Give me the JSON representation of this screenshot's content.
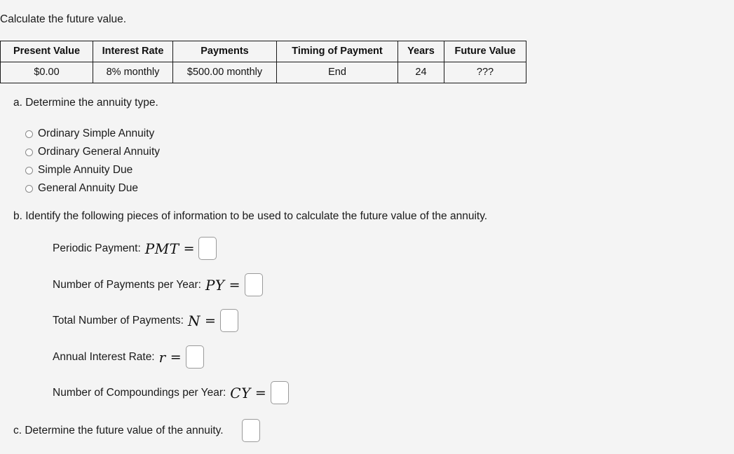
{
  "intro": {
    "text": "Calculate the future value."
  },
  "table": {
    "headers": [
      "Present Value",
      "Interest Rate",
      "Payments",
      "Timing of Payment",
      "Years",
      "Future Value"
    ],
    "rows": [
      [
        "$0.00",
        "8% monthly",
        "$500.00 monthly",
        "End",
        "24",
        "???"
      ]
    ]
  },
  "part_a": {
    "prompt": "a. Determine the annuity type.",
    "options": [
      {
        "label": "Ordinary Simple Annuity",
        "selected": false
      },
      {
        "label": "Ordinary General Annuity",
        "selected": false
      },
      {
        "label": "Simple Annuity Due",
        "selected": false
      },
      {
        "label": "General Annuity Due",
        "selected": false
      }
    ]
  },
  "part_b": {
    "prompt": "b. Identify the following pieces of information to be used to calculate the future value of the annuity.",
    "fields": [
      {
        "label": "Periodic Payment:",
        "symbol": "PMT",
        "equals": "=",
        "value": ""
      },
      {
        "label": "Number of Payments per Year:",
        "symbol": "PY",
        "equals": "=",
        "value": ""
      },
      {
        "label": "Total Number of Payments:",
        "symbol": "N",
        "equals": "=",
        "value": ""
      },
      {
        "label": "Annual Interest Rate:",
        "symbol": "r",
        "equals": "=",
        "value": ""
      },
      {
        "label": "Number of Compoundings per Year:",
        "symbol": "CY",
        "equals": "=",
        "value": ""
      }
    ]
  },
  "part_c": {
    "prompt": "c. Determine the future value of the annuity.",
    "value": ""
  },
  "colors": {
    "background": "#f4f4f4",
    "text": "#1a1a1a",
    "table_border": "#1a1a1a",
    "input_border": "#9a9a9a",
    "input_fill": "#ffffff"
  }
}
